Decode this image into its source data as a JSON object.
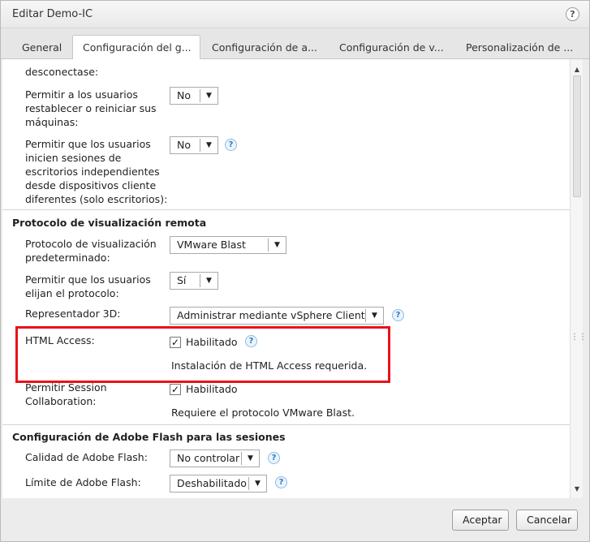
{
  "window": {
    "title": "Editar Demo-IC",
    "help_icon_glyph": "?"
  },
  "tabs": [
    {
      "label": "General"
    },
    {
      "label": "Configuración del g..."
    },
    {
      "label": "Configuración de a..."
    },
    {
      "label": "Configuración de v..."
    },
    {
      "label": "Personalización de ..."
    }
  ],
  "settings": {
    "disconnect_tail": "desconectase:",
    "reset_label_1": "Permitir a los usuarios",
    "reset_label_2": "restablecer o reiniciar sus",
    "reset_label_3": "máquinas:",
    "reset_value": "No",
    "independent_label_1": "Permitir que los usuarios",
    "independent_label_2": "inicien sesiones de",
    "independent_label_3": "escritorios independientes",
    "independent_label_4": "desde dispositivos cliente",
    "independent_label_5": "diferentes (solo escritorios):",
    "independent_value": "No"
  },
  "display_protocol": {
    "section_title": "Protocolo de visualización remota",
    "default_protocol_label_1": "Protocolo de visualización",
    "default_protocol_label_2": "predeterminado:",
    "default_protocol_value": "VMware Blast",
    "choose_protocol_label_1": "Permitir que los usuarios",
    "choose_protocol_label_2": "elijan el protocolo:",
    "choose_protocol_value": "Sí",
    "renderer_label": "Representador 3D:",
    "renderer_value": "Administrar mediante vSphere Client",
    "html_access_label": "HTML Access:",
    "html_access_checkbox_label": "Habilitado",
    "html_access_checked": true,
    "html_access_note": "Instalación de HTML Access requerida.",
    "session_collab_label_1": "Permitir Session",
    "session_collab_label_2": "Collaboration:",
    "session_collab_checkbox_label": "Habilitado",
    "session_collab_checked": true,
    "session_collab_note": "Requiere el protocolo VMware Blast."
  },
  "flash": {
    "section_title": "Configuración de Adobe Flash para las sesiones",
    "quality_label": "Calidad de Adobe Flash:",
    "quality_value": "No controlar",
    "limit_label": "Límite de Adobe Flash:",
    "limit_value": "Deshabilitado"
  },
  "footer": {
    "accept_label": "Aceptar",
    "cancel_label": "Cancelar"
  },
  "colors": {
    "highlight": "#e8121b",
    "help_icon": "#2f7bc4"
  }
}
